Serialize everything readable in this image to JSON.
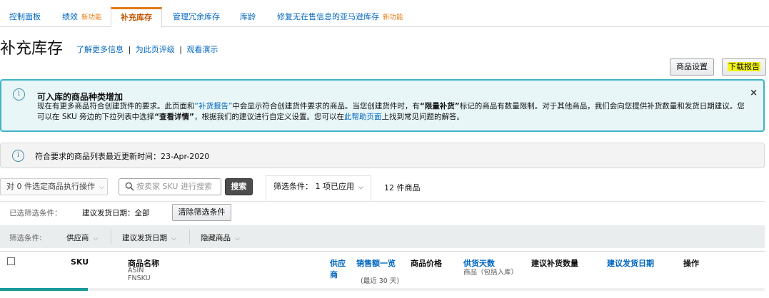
{
  "tabs": [
    {
      "label": "控制面板",
      "new": ""
    },
    {
      "label": "绩效",
      "new": "新功能"
    },
    {
      "label": "补充库存",
      "new": ""
    },
    {
      "label": "管理冗余库存",
      "new": ""
    },
    {
      "label": "库龄",
      "new": ""
    },
    {
      "label": "修复无在售信息的亚马逊库存",
      "new": "新功能"
    }
  ],
  "page": {
    "title": "补充库存",
    "link_learn_more": "了解更多信息",
    "link_rate": "为此页评级",
    "link_demo": "观看演示",
    "sep": "|"
  },
  "buttons": {
    "settings": "商品设置",
    "download": "下载报告"
  },
  "info": {
    "icon_name": "info-icon",
    "title": "可入库的商品种类增加",
    "body_1": "现在有更多商品符合创建货件的要求。此页面和",
    "link_report": "“补货报告”",
    "body_2": "中会显示符合创建货件要求的商品。当您创建货件时，有",
    "bold_limited": "“限量补货”",
    "body_3": "标记的商品有数量限制。对于其他商品，我们会向您提供补货数量和发货日期建议。您可以在 SKU 旁边的下拉列表中选择",
    "bold_details": "“查看详情”",
    "body_4": "，根据我们的建议进行自定义设置。您可以在",
    "link_help": "此帮助页面",
    "body_5": "上找到常见问题的解答。",
    "close": "×"
  },
  "updated": {
    "text": "符合要求的商品列表最近更新时间：23-Apr-2020"
  },
  "toolbar": {
    "bulk_action": "对 0 件选定商品执行操作",
    "search_placeholder": "按卖家 SKU 进行搜索",
    "search_button": "搜索",
    "filter_tab": "筛选条件： 1 项已应用",
    "item_count": "12 件商品"
  },
  "applied": {
    "label": "已选筛选条件：",
    "value": "建议发货日期：全部",
    "clear_button": "清除筛选条件"
  },
  "filter_bar": {
    "label": "筛选条件:",
    "items": [
      "供应商",
      "建议发货日期",
      "隐藏商品"
    ]
  },
  "table": {
    "col_sku": "SKU",
    "col_name": "商品名称",
    "col_name_sub1": "ASIN",
    "col_name_sub2": "FNSKU",
    "col_supplier_1": "供应",
    "col_supplier_2": "商",
    "col_sales": "销售额一览",
    "col_sales_sub": "(最近 30 天)",
    "col_price": "商品价格",
    "col_days": "供货天数",
    "col_days_sub": "商品（包括入库）",
    "col_qty": "建议补货数量",
    "col_ship_date": "建议发货日期",
    "col_action": "操作"
  },
  "colors": {
    "accent_orange": "#e47911",
    "link_blue": "#0066c0",
    "info_border": "#3eb4c4",
    "info_bg": "#e8f6f8",
    "highlight_yellow": "#f5f516"
  }
}
